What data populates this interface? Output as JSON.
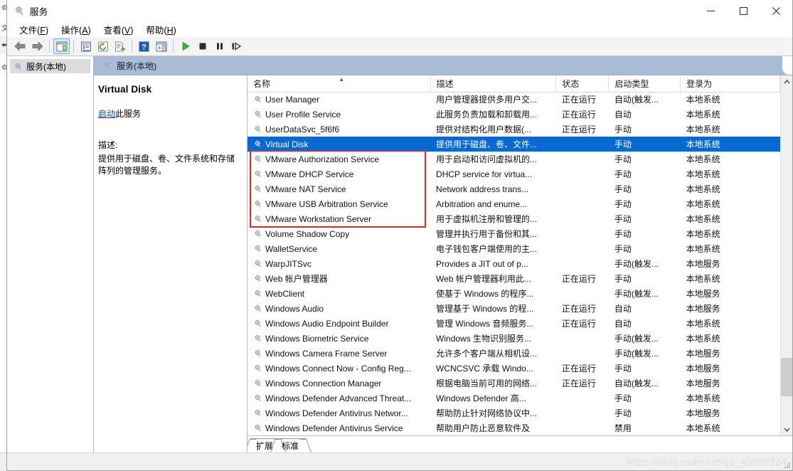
{
  "window": {
    "title": "服务",
    "app_icon": "services-gear-icon",
    "controls": {
      "minimize": "—",
      "maximize": "☐",
      "close": "✕"
    }
  },
  "menubar": [
    {
      "name": "file",
      "label": "文件",
      "accel": "F"
    },
    {
      "name": "action",
      "label": "操作",
      "accel": "A"
    },
    {
      "name": "view",
      "label": "查看",
      "accel": "V"
    },
    {
      "name": "help",
      "label": "帮助",
      "accel": "H"
    }
  ],
  "toolbar": [
    {
      "name": "back-icon",
      "type": "icon"
    },
    {
      "name": "forward-icon",
      "type": "icon"
    },
    {
      "name": "show-hide-tree-icon",
      "type": "icon",
      "active": true
    },
    {
      "name": "properties-icon",
      "type": "icon"
    },
    {
      "name": "refresh-icon",
      "type": "icon"
    },
    {
      "name": "export-list-icon",
      "type": "icon"
    },
    {
      "name": "help-icon",
      "type": "icon"
    },
    {
      "name": "show-action-pane-icon",
      "type": "icon"
    },
    {
      "name": "start-service-icon",
      "type": "icon"
    },
    {
      "name": "stop-service-icon",
      "type": "icon"
    },
    {
      "name": "pause-service-icon",
      "type": "icon"
    },
    {
      "name": "restart-service-icon",
      "type": "icon"
    }
  ],
  "tree": {
    "root_label": "服务(本地)"
  },
  "console_header": {
    "label": "服务(本地)"
  },
  "detail": {
    "service_name": "Virtual Disk",
    "action_link": "启动",
    "action_suffix": "此服务",
    "description_label": "描述:",
    "description_text": "提供用于磁盘、卷、文件系统和存储阵列的管理服务。"
  },
  "list": {
    "columns": [
      {
        "name": "name",
        "label": "名称",
        "sorted": true
      },
      {
        "name": "description",
        "label": "描述"
      },
      {
        "name": "status",
        "label": "状态"
      },
      {
        "name": "startup",
        "label": "启动类型"
      },
      {
        "name": "logon",
        "label": "登录为"
      }
    ],
    "rows": [
      {
        "name": "User Manager",
        "description": "用户管理器提供多用户交...",
        "status": "正在运行",
        "startup": "自动(触发...",
        "logon": "本地系统",
        "selected": false
      },
      {
        "name": "User Profile Service",
        "description": "此服务负责加载和卸载用...",
        "status": "正在运行",
        "startup": "自动",
        "logon": "本地系统",
        "selected": false
      },
      {
        "name": "UserDataSvc_5f6f6",
        "description": "提供对结构化用户数据(...",
        "status": "正在运行",
        "startup": "手动",
        "logon": "本地系统",
        "selected": false
      },
      {
        "name": "Virtual Disk",
        "description": "提供用于磁盘、卷、文件...",
        "status": "",
        "startup": "手动",
        "logon": "本地系统",
        "selected": true
      },
      {
        "name": "VMware Authorization Service",
        "description": "用于启动和访问虚拟机的...",
        "status": "",
        "startup": "手动",
        "logon": "本地系统",
        "selected": false
      },
      {
        "name": "VMware DHCP Service",
        "description": "DHCP service for virtua...",
        "status": "",
        "startup": "手动",
        "logon": "本地系统",
        "selected": false
      },
      {
        "name": "VMware NAT Service",
        "description": "Network address trans...",
        "status": "",
        "startup": "手动",
        "logon": "本地系统",
        "selected": false
      },
      {
        "name": "VMware USB Arbitration Service",
        "description": "Arbitration and enume...",
        "status": "",
        "startup": "手动",
        "logon": "本地系统",
        "selected": false
      },
      {
        "name": "VMware Workstation Server",
        "description": "用于虚拟机注册和管理的...",
        "status": "",
        "startup": "手动",
        "logon": "本地系统",
        "selected": false
      },
      {
        "name": "Volume Shadow Copy",
        "description": "管理并执行用于备份和其...",
        "status": "",
        "startup": "手动",
        "logon": "本地系统",
        "selected": false
      },
      {
        "name": "WalletService",
        "description": "电子钱包客户端使用的主...",
        "status": "",
        "startup": "手动",
        "logon": "本地系统",
        "selected": false
      },
      {
        "name": "WarpJITSvc",
        "description": "Provides a JIT out of p...",
        "status": "",
        "startup": "手动(触发...",
        "logon": "本地服务",
        "selected": false
      },
      {
        "name": "Web 帐户管理器",
        "description": "Web 帐户管理器利用此...",
        "status": "正在运行",
        "startup": "手动",
        "logon": "本地系统",
        "selected": false
      },
      {
        "name": "WebClient",
        "description": "使基于 Windows 的程序...",
        "status": "",
        "startup": "手动(触发...",
        "logon": "本地服务",
        "selected": false
      },
      {
        "name": "Windows Audio",
        "description": "管理基于 Windows 的程...",
        "status": "正在运行",
        "startup": "自动",
        "logon": "本地服务",
        "selected": false
      },
      {
        "name": "Windows Audio Endpoint Builder",
        "description": "管理 Windows 音频服务...",
        "status": "正在运行",
        "startup": "自动",
        "logon": "本地系统",
        "selected": false
      },
      {
        "name": "Windows Biometric Service",
        "description": "Windows 生物识别服务...",
        "status": "",
        "startup": "手动(触发...",
        "logon": "本地系统",
        "selected": false
      },
      {
        "name": "Windows Camera Frame Server",
        "description": "允许多个客户端从相机设...",
        "status": "",
        "startup": "手动(触发...",
        "logon": "本地服务",
        "selected": false
      },
      {
        "name": "Windows Connect Now - Config Reg...",
        "description": "WCNCSVC 承载 Windo...",
        "status": "正在运行",
        "startup": "手动",
        "logon": "本地服务",
        "selected": false
      },
      {
        "name": "Windows Connection Manager",
        "description": "根据电脑当前可用的网络...",
        "status": "正在运行",
        "startup": "自动(触发...",
        "logon": "本地服务",
        "selected": false
      },
      {
        "name": "Windows Defender Advanced Threat...",
        "description": "Windows Defender 高...",
        "status": "",
        "startup": "手动",
        "logon": "本地系统",
        "selected": false
      },
      {
        "name": "Windows Defender Antivirus Networ...",
        "description": "帮助防止针对网络协议中...",
        "status": "",
        "startup": "手动",
        "logon": "本地服务",
        "selected": false
      },
      {
        "name": "Windows Defender Antivirus Service",
        "description": "帮助用户防止恶意软件及",
        "status": "",
        "startup": "禁用",
        "logon": "本地系统",
        "selected": false
      }
    ]
  },
  "annotation": {
    "highlight_color": "#e8271c",
    "highlighted_rows": [
      "VMware Authorization Service",
      "VMware DHCP Service",
      "VMware NAT Service",
      "VMware USB Arbitration Service",
      "VMware Workstation Server"
    ]
  },
  "tabs": [
    {
      "name": "extended",
      "label": "扩展"
    },
    {
      "name": "standard",
      "label": "标准"
    }
  ],
  "statusbar": {
    "watermark": "https://blog.csdn.net/qq_45088324"
  },
  "colors": {
    "selection": "#0a68d2",
    "console_header": "#a7bcd6",
    "link": "#0645ad",
    "annotation": "#e8271c"
  }
}
